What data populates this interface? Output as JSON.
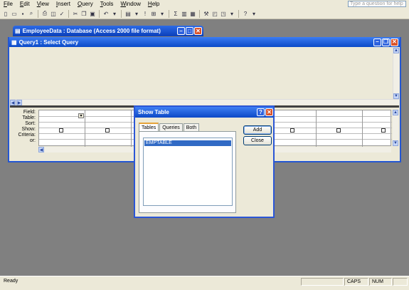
{
  "menubar": {
    "items": [
      {
        "label": "File",
        "u": "F",
        "rest": "ile"
      },
      {
        "label": "Edit",
        "u": "E",
        "rest": "dit"
      },
      {
        "label": "View",
        "u": "V",
        "rest": "iew"
      },
      {
        "label": "Insert",
        "u": "I",
        "rest": "nsert"
      },
      {
        "label": "Query",
        "u": "Q",
        "rest": "uery"
      },
      {
        "label": "Tools",
        "u": "T",
        "rest": "ools"
      },
      {
        "label": "Window",
        "u": "W",
        "rest": "indow"
      },
      {
        "label": "Help",
        "u": "H",
        "rest": "elp"
      }
    ],
    "help_placeholder": "Type a question for help"
  },
  "db_window": {
    "title": "EmployeeData : Database (Access 2000 file format)"
  },
  "query_window": {
    "title": "Query1 : Select Query"
  },
  "design_grid": {
    "row_labels": [
      "Field:",
      "Table:",
      "Sort:",
      "Show:",
      "Criteria:",
      "or:"
    ]
  },
  "dialog": {
    "title": "Show Table",
    "help_glyph": "?",
    "close_glyph": "✕",
    "tabs": [
      "Tables",
      "Queries",
      "Both"
    ],
    "tables": [
      "EMPTABLE"
    ],
    "add_label": "Add",
    "close_label": "Close"
  },
  "statusbar": {
    "status": "Ready",
    "caps": "CAPS",
    "num": "NUM"
  }
}
